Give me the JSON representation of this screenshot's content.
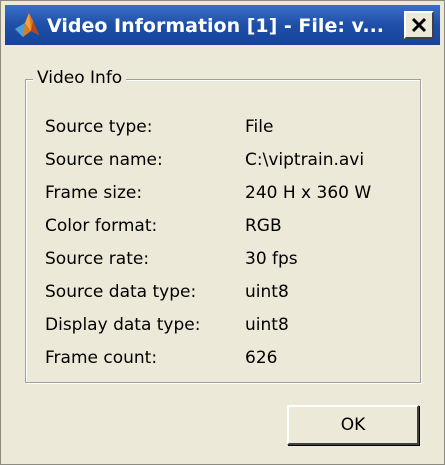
{
  "window": {
    "title": "Video Information [1] - File: v...",
    "icon": "matlab-logo-icon",
    "title_color": "#ffffff",
    "titlebar_color": "#1e4fa8",
    "background_color": "#ece9d8"
  },
  "group": {
    "legend": "Video Info"
  },
  "rows": [
    {
      "label": "Source type:",
      "value": "File"
    },
    {
      "label": "Source name:",
      "value": "C:\\viptrain.avi"
    },
    {
      "label": "Frame size:",
      "value": "240 H x 360 W"
    },
    {
      "label": "Color format:",
      "value": "RGB"
    },
    {
      "label": "Source rate:",
      "value": "30 fps"
    },
    {
      "label": "Source data type:",
      "value": "uint8"
    },
    {
      "label": "Display data type:",
      "value": "uint8"
    },
    {
      "label": "Frame count:",
      "value": "626"
    }
  ],
  "buttons": {
    "ok_label": "OK",
    "close_icon": "close-icon"
  }
}
